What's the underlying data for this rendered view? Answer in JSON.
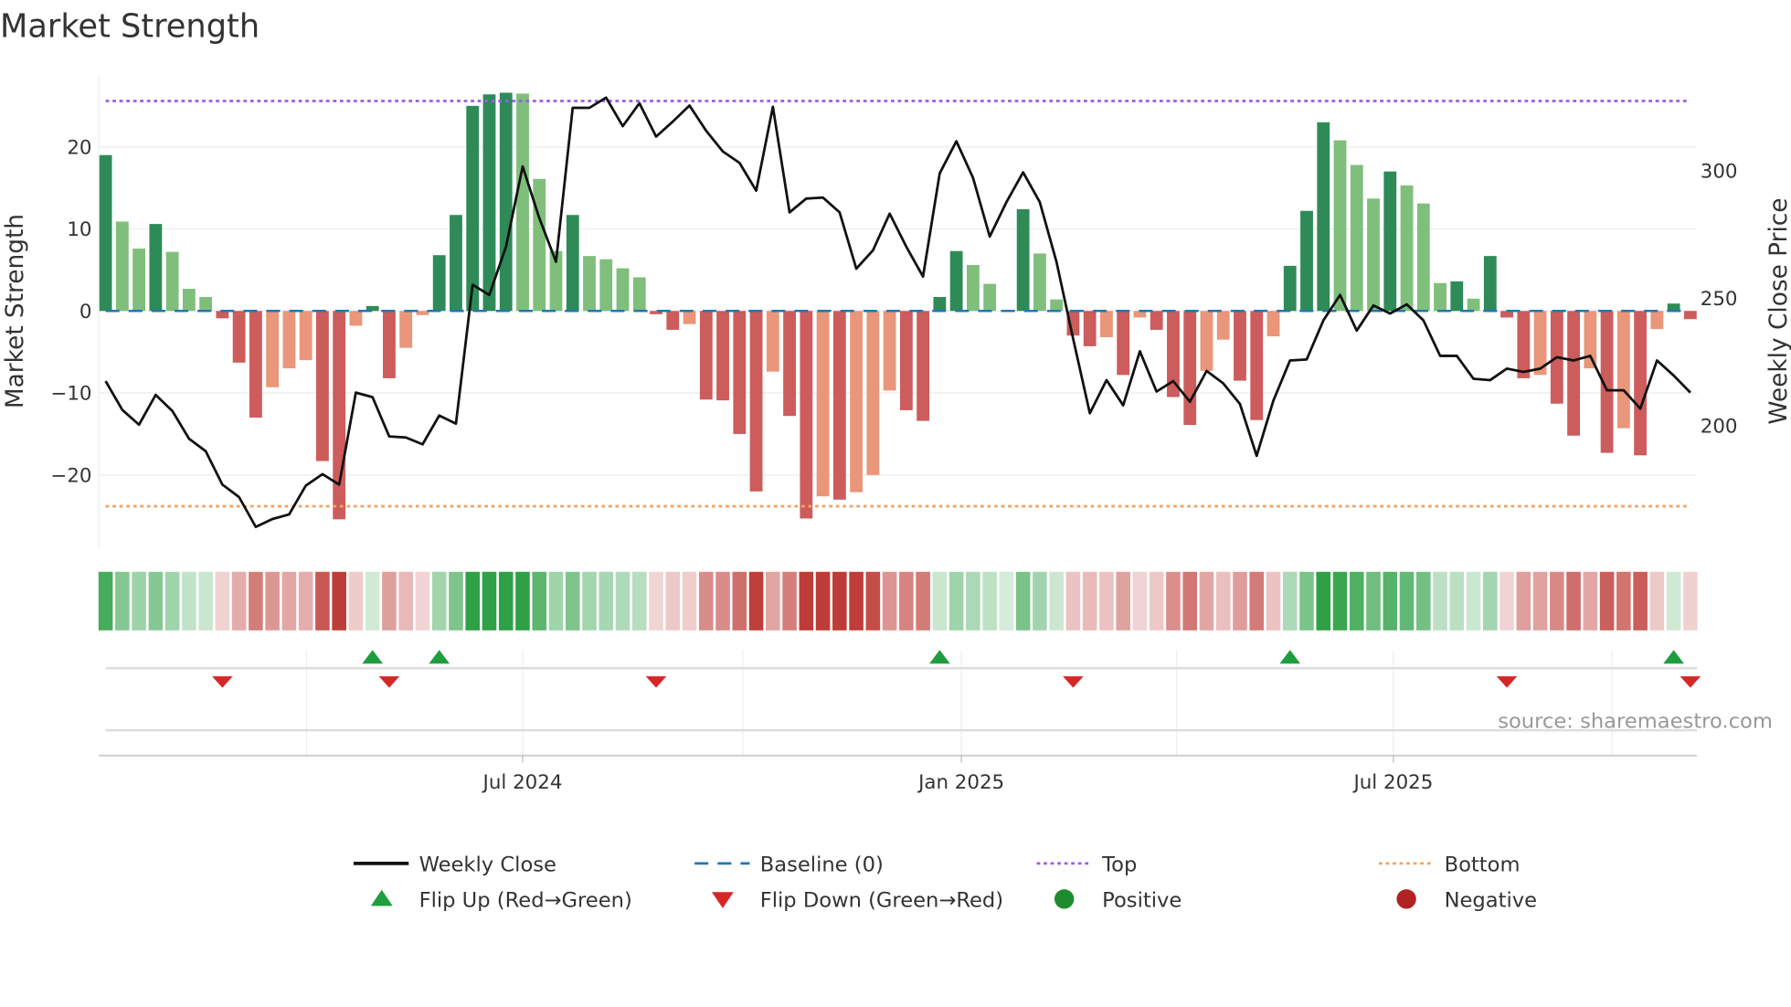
{
  "chart_data": {
    "type": "bar",
    "title": "Market Strength",
    "ylabel": "Market Strength",
    "y2label": "Weekly Close Price",
    "ylim": [
      -29,
      28.8
    ],
    "y2lim": [
      151.8,
      337.8
    ],
    "yticks": [
      -20,
      -10,
      0,
      10,
      20
    ],
    "yticklabels": [
      "−20",
      "−10",
      "0",
      "10",
      "20"
    ],
    "y2ticks": [
      200,
      250,
      300
    ],
    "y2ticklabels": [
      "200",
      "250",
      "300"
    ],
    "xticks": [
      {
        "index": 25,
        "label": "Jul 2024"
      },
      {
        "index": 51.3,
        "label": "Jan 2025"
      },
      {
        "index": 77.2,
        "label": "Jul 2025"
      }
    ],
    "quarter_gridlines": [
      12.05,
      25,
      38.2,
      51.3,
      64.2,
      77.2,
      90.3
    ],
    "top_level": 25.6,
    "bottom_level": -23.8,
    "baseline": 0,
    "strength": [
      19.0,
      10.9,
      7.6,
      10.6,
      7.2,
      2.7,
      1.7,
      -0.9,
      -6.3,
      -13.0,
      -9.3,
      -7.0,
      -6.0,
      -18.3,
      -25.4,
      -1.8,
      0.6,
      -8.2,
      -4.5,
      -0.5,
      6.8,
      11.7,
      25.0,
      26.4,
      26.6,
      26.5,
      16.1,
      7.3,
      11.7,
      6.7,
      6.3,
      5.2,
      4.1,
      -0.4,
      -2.3,
      -1.6,
      -10.8,
      -10.9,
      -15.0,
      -22.0,
      -7.4,
      -12.8,
      -25.3,
      -22.6,
      -23.0,
      -22.1,
      -20.0,
      -9.7,
      -12.1,
      -13.4,
      1.7,
      7.3,
      5.6,
      3.3,
      0,
      12.4,
      7.0,
      1.4,
      -3.0,
      -4.3,
      -3.2,
      -7.8,
      -0.8,
      -2.3,
      -10.5,
      -13.9,
      -7.3,
      -3.5,
      -8.5,
      -13.3,
      -3.1,
      5.5,
      12.2,
      23.0,
      20.8,
      17.8,
      13.7,
      17.0,
      15.3,
      13.1,
      3.4,
      3.6,
      1.5,
      6.7,
      -0.8,
      -8.2,
      -7.8,
      -11.3,
      -15.2,
      -7.0,
      -17.3,
      -14.3,
      -17.6,
      -2.2,
      0.9,
      -1.0
    ],
    "weekly_close": [
      217.6,
      206.3,
      200.5,
      212.2,
      205.9,
      195.0,
      190.1,
      177.0,
      172.1,
      160.4,
      163.5,
      165.3,
      176.6,
      181.1,
      177.0,
      213.1,
      211.3,
      195.9,
      195.5,
      192.8,
      204.1,
      200.9,
      255.4,
      251.4,
      270.3,
      301.8,
      281.5,
      264.4,
      324.8,
      324.8,
      328.8,
      317.6,
      326.6,
      313.5,
      319.4,
      325.7,
      315.8,
      307.7,
      303.2,
      292.3,
      325.2,
      283.8,
      289.2,
      289.6,
      283.8,
      261.7,
      268.9,
      283.3,
      270.3,
      258.6,
      299.1,
      311.7,
      297.3,
      274.3,
      287.8,
      299.5,
      287.8,
      264.4,
      234.2,
      205.0,
      218.0,
      208.1,
      229.3,
      213.5,
      217.6,
      209.5,
      221.6,
      216.7,
      208.6,
      188.3,
      209.9,
      225.7,
      226.1,
      241.4,
      251.4,
      237.4,
      247.3,
      244.1,
      247.7,
      241.4,
      227.5,
      227.5,
      218.5,
      218.0,
      222.5,
      221.2,
      222.5,
      227.0,
      225.7,
      227.5,
      214.0,
      214.0,
      206.8,
      225.7,
      219.8,
      213.1
    ],
    "flip_up_indices": [
      16,
      20,
      50,
      71,
      94
    ],
    "flip_down_indices": [
      7,
      17,
      33,
      58,
      84,
      95
    ],
    "legend": {
      "placement": "bottom",
      "items": [
        {
          "label": "Weekly Close",
          "kind": "line-solid",
          "color": "#111111"
        },
        {
          "label": "Baseline (0)",
          "kind": "line-dashed",
          "color": "#1f77b4"
        },
        {
          "label": "Top",
          "kind": "line-dotted",
          "color": "#9b5de5"
        },
        {
          "label": "Bottom",
          "kind": "line-dotted",
          "color": "#f4a261"
        },
        {
          "label": "Flip Up (Red→Green)",
          "kind": "triangle-up",
          "color": "#1e9e3e"
        },
        {
          "label": "Flip Down (Green→Red)",
          "kind": "triangle-down",
          "color": "#d62728"
        },
        {
          "label": "Positive",
          "kind": "dot",
          "color": "#1e8c2c"
        },
        {
          "label": "Negative",
          "kind": "dot",
          "color": "#b22222"
        }
      ]
    },
    "colors": {
      "pos_rising": "#2e8b57",
      "pos_falling": "#7fbf7b",
      "neg_falling": "#cd5c5c",
      "neg_rising": "#e9967a",
      "top": "#9b5de5",
      "bottom": "#f4a261",
      "baseline": "#1f77b4",
      "close": "#111111"
    },
    "source": "source: sharemaestro.com"
  }
}
